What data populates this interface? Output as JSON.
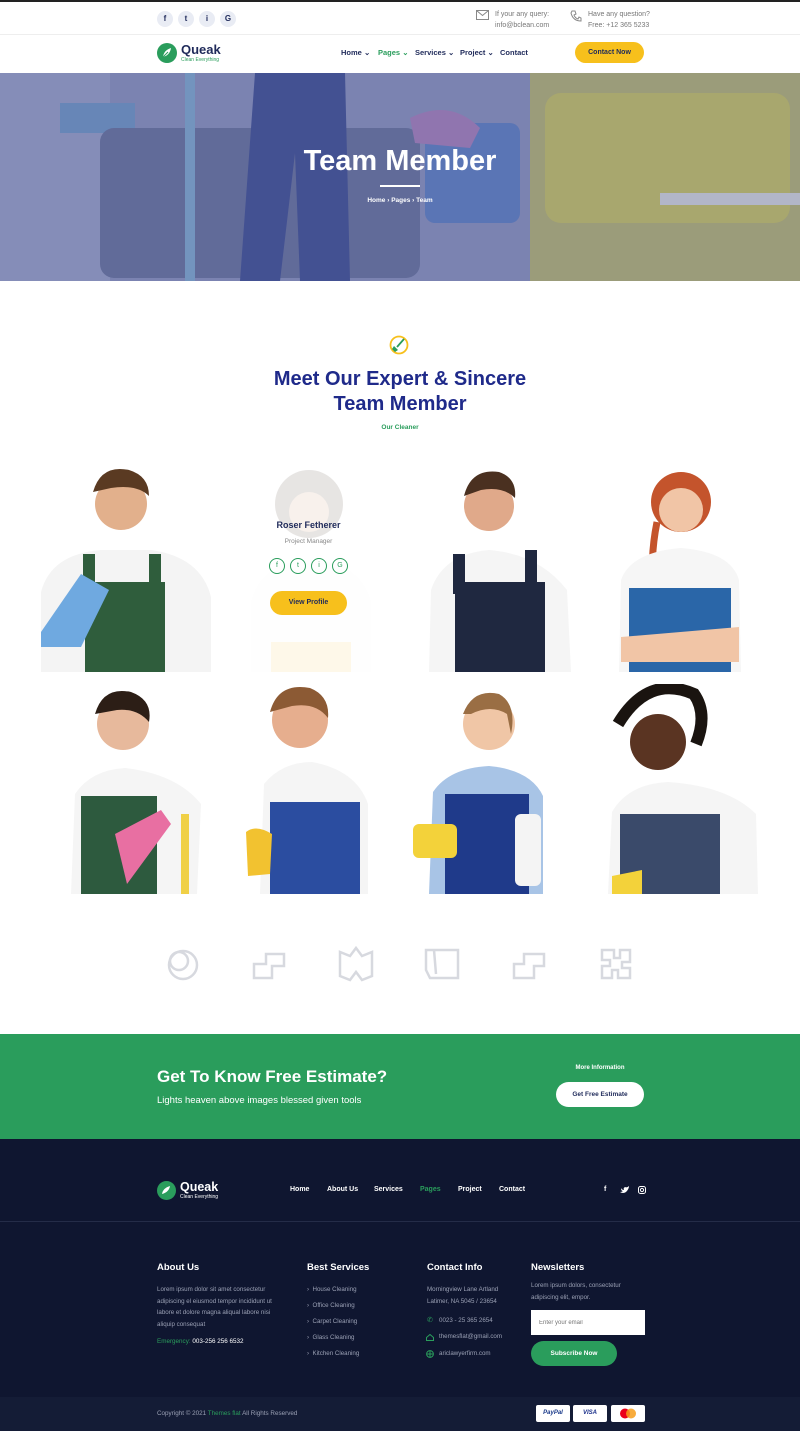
{
  "topbar": {
    "social": [
      "f",
      "t",
      "i",
      "G"
    ],
    "query_label": "If your any query:",
    "query_value": "info@bclean.com",
    "question_label": "Have any question?",
    "question_value": "Free: +12 365 5233"
  },
  "brand": {
    "name": "Queak",
    "tagline": "Clean Everything"
  },
  "nav": {
    "items": [
      "Home",
      "Pages",
      "Services",
      "Project",
      "Contact"
    ],
    "active": "Pages",
    "cta": "Contact Now"
  },
  "hero": {
    "title": "Team Member",
    "breadcrumb": [
      "Home",
      "Pages",
      "Team"
    ]
  },
  "section": {
    "title_line1": "Meet Our Expert & Sincere",
    "title_line2": "Team Member",
    "subtitle": "Our Cleaner"
  },
  "team": {
    "featured": {
      "name": "Roser Fetherer",
      "role": "Project Manager",
      "button": "View Profile",
      "social": [
        "f",
        "t",
        "i",
        "G"
      ]
    }
  },
  "estimate": {
    "title": "Get To Know Free Estimate?",
    "subtitle": "Lights heaven above images blessed given tools",
    "more": "More Information",
    "button": "Get Free Estimate"
  },
  "footer": {
    "nav": [
      "Home",
      "About Us",
      "Services",
      "Pages",
      "Project",
      "Contact"
    ],
    "nav_active": "Pages",
    "about": {
      "heading": "About Us",
      "text": "Lorem ipsum dolor sit amet consectetur adipiscing el eiusmod tempor incididunt ut labore et dolore magna aliqual labore nisi aliquip consequat",
      "emergency_label": "Emergency:",
      "emergency_value": "003-256 256 6532"
    },
    "services": {
      "heading": "Best Services",
      "items": [
        "House Cleaning",
        "Office Cleaning",
        "Carpet Cleaning",
        "Glass Cleaning",
        "Kitchen Cleaning"
      ]
    },
    "contact": {
      "heading": "Contact Info",
      "address": "Morningview Lane Artland Latimer, NA 5045 / 23654",
      "phone": "0023 - 25 365 2654",
      "email": "themesflat@gmail.com",
      "web": "ariclawyerfirm.com"
    },
    "newsletter": {
      "heading": "Newsletters",
      "text": "Lorem ipsum dolors, consectetur adipiscing elit, empor.",
      "placeholder": "Enter your email",
      "button": "Subscribe Now"
    },
    "copyright_prefix": "Copyright © 2021",
    "copyright_brand": "Themes flat",
    "copyright_suffix": "All Rights Reserved",
    "payments": [
      "PayPal",
      "VISA",
      "MC"
    ]
  },
  "colors": {
    "navy": "#1f2a5a",
    "green": "#2a9d5c",
    "yellow": "#f7c01c",
    "footer": "#0f1630"
  }
}
